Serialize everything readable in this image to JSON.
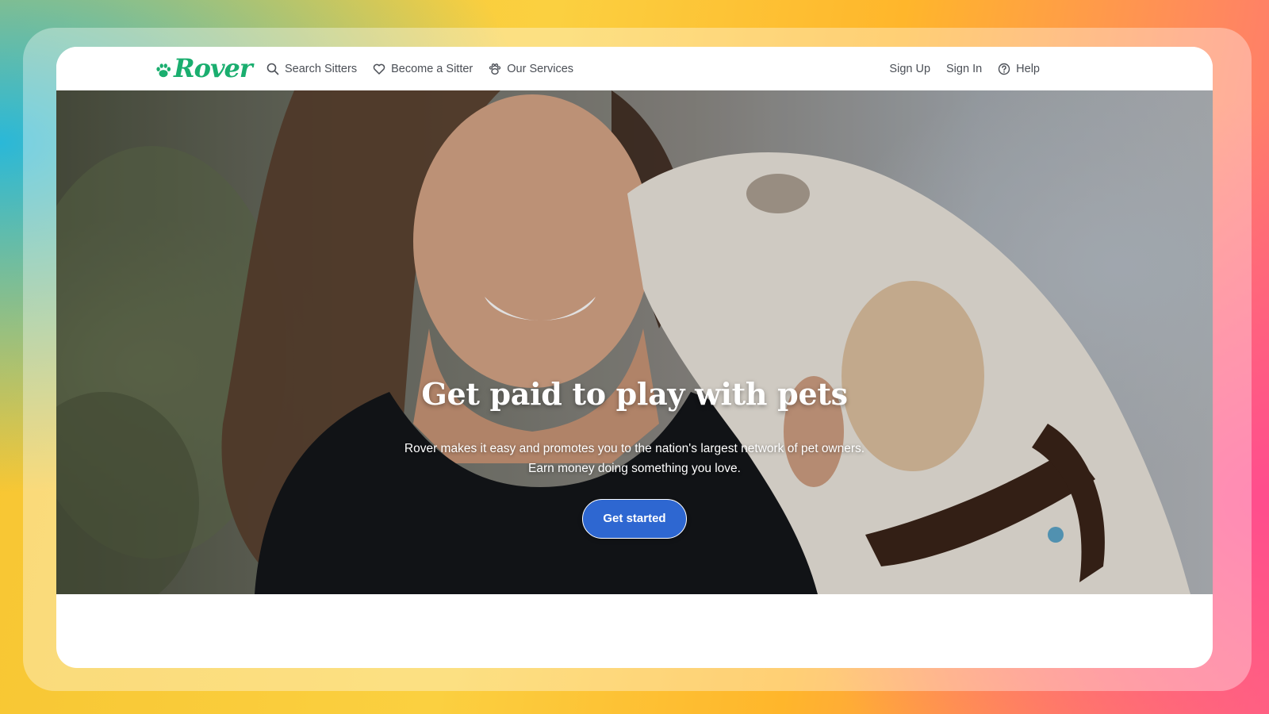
{
  "brand": {
    "name": "Rover",
    "color": "#1aae6f",
    "icon": "paw-icon"
  },
  "nav": {
    "left": [
      {
        "label": "Search Sitters",
        "icon": "search-icon"
      },
      {
        "label": "Become a Sitter",
        "icon": "heart-icon"
      },
      {
        "label": "Our Services",
        "icon": "paw-services-icon"
      }
    ],
    "right": [
      {
        "label": "Sign Up"
      },
      {
        "label": "Sign In"
      },
      {
        "label": "Help",
        "icon": "help-circle-icon"
      }
    ]
  },
  "hero": {
    "title": "Get paid to play with pets",
    "subtitle_line1": "Rover makes it easy and promotes you to the nation's largest network of pet owners.",
    "subtitle_line2": "Earn money doing something you love.",
    "cta_label": "Get started",
    "image_description": "woman-with-dog-photo"
  },
  "colors": {
    "cta": "#2e67d1",
    "nav_text": "#4b4f56"
  }
}
